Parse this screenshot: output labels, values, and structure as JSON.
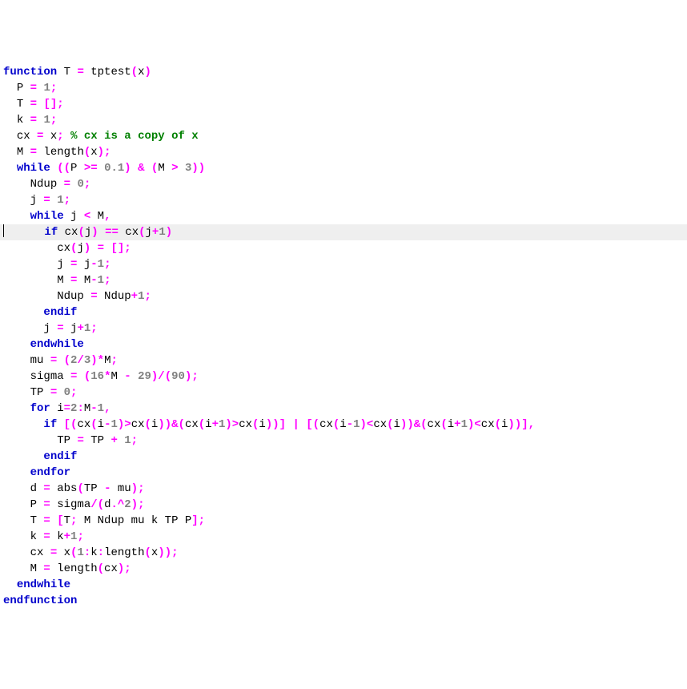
{
  "code": {
    "lines": [
      {
        "indent": 0,
        "hl": false,
        "tokens": [
          [
            "k",
            "function"
          ],
          [
            "id",
            " T "
          ],
          [
            "op",
            "="
          ],
          [
            "id",
            " tptest"
          ],
          [
            "op",
            "("
          ],
          [
            "id",
            "x"
          ],
          [
            "op",
            ")"
          ]
        ]
      },
      {
        "indent": 1,
        "hl": false,
        "tokens": [
          [
            "id",
            "P "
          ],
          [
            "op",
            "="
          ],
          [
            "id",
            " "
          ],
          [
            "n",
            "1"
          ],
          [
            "op",
            ";"
          ]
        ]
      },
      {
        "indent": 1,
        "hl": false,
        "tokens": [
          [
            "id",
            "T "
          ],
          [
            "op",
            "="
          ],
          [
            "id",
            " "
          ],
          [
            "op",
            "[];"
          ]
        ]
      },
      {
        "indent": 1,
        "hl": false,
        "tokens": [
          [
            "id",
            "k "
          ],
          [
            "op",
            "="
          ],
          [
            "id",
            " "
          ],
          [
            "n",
            "1"
          ],
          [
            "op",
            ";"
          ]
        ]
      },
      {
        "indent": 1,
        "hl": false,
        "tokens": [
          [
            "id",
            "cx "
          ],
          [
            "op",
            "="
          ],
          [
            "id",
            " x"
          ],
          [
            "op",
            ";"
          ],
          [
            "id",
            " "
          ],
          [
            "c",
            "% cx is a copy of x"
          ]
        ]
      },
      {
        "indent": 1,
        "hl": false,
        "tokens": [
          [
            "id",
            "M "
          ],
          [
            "op",
            "="
          ],
          [
            "id",
            " length"
          ],
          [
            "op",
            "("
          ],
          [
            "id",
            "x"
          ],
          [
            "op",
            ");"
          ]
        ]
      },
      {
        "indent": 1,
        "hl": false,
        "tokens": [
          [
            "k",
            "while"
          ],
          [
            "id",
            " "
          ],
          [
            "op",
            "(("
          ],
          [
            "id",
            "P "
          ],
          [
            "op",
            ">="
          ],
          [
            "id",
            " "
          ],
          [
            "n",
            "0.1"
          ],
          [
            "op",
            ")"
          ],
          [
            "id",
            " "
          ],
          [
            "op",
            "&"
          ],
          [
            "id",
            " "
          ],
          [
            "op",
            "("
          ],
          [
            "id",
            "M "
          ],
          [
            "op",
            ">"
          ],
          [
            "id",
            " "
          ],
          [
            "n",
            "3"
          ],
          [
            "op",
            "))"
          ]
        ]
      },
      {
        "indent": 2,
        "hl": false,
        "tokens": [
          [
            "id",
            "Ndup "
          ],
          [
            "op",
            "="
          ],
          [
            "id",
            " "
          ],
          [
            "n",
            "0"
          ],
          [
            "op",
            ";"
          ]
        ]
      },
      {
        "indent": 2,
        "hl": false,
        "tokens": [
          [
            "id",
            "j "
          ],
          [
            "op",
            "="
          ],
          [
            "id",
            " "
          ],
          [
            "n",
            "1"
          ],
          [
            "op",
            ";"
          ]
        ]
      },
      {
        "indent": 2,
        "hl": false,
        "tokens": [
          [
            "k",
            "while"
          ],
          [
            "id",
            " j "
          ],
          [
            "op",
            "<"
          ],
          [
            "id",
            " M"
          ],
          [
            "op",
            ","
          ]
        ]
      },
      {
        "indent": 3,
        "hl": true,
        "tokens": [
          [
            "k",
            "if"
          ],
          [
            "id",
            " cx"
          ],
          [
            "op",
            "("
          ],
          [
            "id",
            "j"
          ],
          [
            "op",
            ")"
          ],
          [
            "id",
            " "
          ],
          [
            "op",
            "=="
          ],
          [
            "id",
            " cx"
          ],
          [
            "op",
            "("
          ],
          [
            "id",
            "j"
          ],
          [
            "op",
            "+"
          ],
          [
            "n",
            "1"
          ],
          [
            "op",
            ")"
          ]
        ]
      },
      {
        "indent": 4,
        "hl": false,
        "tokens": [
          [
            "id",
            "cx"
          ],
          [
            "op",
            "("
          ],
          [
            "id",
            "j"
          ],
          [
            "op",
            ")"
          ],
          [
            "id",
            " "
          ],
          [
            "op",
            "="
          ],
          [
            "id",
            " "
          ],
          [
            "op",
            "[];"
          ]
        ]
      },
      {
        "indent": 4,
        "hl": false,
        "tokens": [
          [
            "id",
            "j "
          ],
          [
            "op",
            "="
          ],
          [
            "id",
            " j"
          ],
          [
            "op",
            "-"
          ],
          [
            "n",
            "1"
          ],
          [
            "op",
            ";"
          ]
        ]
      },
      {
        "indent": 4,
        "hl": false,
        "tokens": [
          [
            "id",
            "M "
          ],
          [
            "op",
            "="
          ],
          [
            "id",
            " M"
          ],
          [
            "op",
            "-"
          ],
          [
            "n",
            "1"
          ],
          [
            "op",
            ";"
          ]
        ]
      },
      {
        "indent": 4,
        "hl": false,
        "tokens": [
          [
            "id",
            "Ndup "
          ],
          [
            "op",
            "="
          ],
          [
            "id",
            " Ndup"
          ],
          [
            "op",
            "+"
          ],
          [
            "n",
            "1"
          ],
          [
            "op",
            ";"
          ]
        ]
      },
      {
        "indent": 3,
        "hl": false,
        "tokens": [
          [
            "k",
            "endif"
          ]
        ]
      },
      {
        "indent": 3,
        "hl": false,
        "tokens": [
          [
            "id",
            "j "
          ],
          [
            "op",
            "="
          ],
          [
            "id",
            " j"
          ],
          [
            "op",
            "+"
          ],
          [
            "n",
            "1"
          ],
          [
            "op",
            ";"
          ]
        ]
      },
      {
        "indent": 2,
        "hl": false,
        "tokens": [
          [
            "k",
            "endwhile"
          ]
        ]
      },
      {
        "indent": 2,
        "hl": false,
        "tokens": [
          [
            "id",
            "mu "
          ],
          [
            "op",
            "="
          ],
          [
            "id",
            " "
          ],
          [
            "op",
            "("
          ],
          [
            "n",
            "2"
          ],
          [
            "op",
            "/"
          ],
          [
            "n",
            "3"
          ],
          [
            "op",
            ")*"
          ],
          [
            "id",
            "M"
          ],
          [
            "op",
            ";"
          ]
        ]
      },
      {
        "indent": 2,
        "hl": false,
        "tokens": [
          [
            "id",
            "sigma "
          ],
          [
            "op",
            "="
          ],
          [
            "id",
            " "
          ],
          [
            "op",
            "("
          ],
          [
            "n",
            "16"
          ],
          [
            "op",
            "*"
          ],
          [
            "id",
            "M "
          ],
          [
            "op",
            "-"
          ],
          [
            "id",
            " "
          ],
          [
            "n",
            "29"
          ],
          [
            "op",
            ")/("
          ],
          [
            "n",
            "90"
          ],
          [
            "op",
            ");"
          ]
        ]
      },
      {
        "indent": 2,
        "hl": false,
        "tokens": [
          [
            "id",
            "TP "
          ],
          [
            "op",
            "="
          ],
          [
            "id",
            " "
          ],
          [
            "n",
            "0"
          ],
          [
            "op",
            ";"
          ]
        ]
      },
      {
        "indent": 2,
        "hl": false,
        "tokens": [
          [
            "k",
            "for"
          ],
          [
            "id",
            " i"
          ],
          [
            "op",
            "="
          ],
          [
            "n",
            "2"
          ],
          [
            "op",
            ":"
          ],
          [
            "id",
            "M"
          ],
          [
            "op",
            "-"
          ],
          [
            "n",
            "1"
          ],
          [
            "op",
            ","
          ]
        ]
      },
      {
        "indent": 3,
        "hl": false,
        "tokens": [
          [
            "k",
            "if"
          ],
          [
            "id",
            " "
          ],
          [
            "op",
            "[("
          ],
          [
            "id",
            "cx"
          ],
          [
            "op",
            "("
          ],
          [
            "id",
            "i"
          ],
          [
            "op",
            "-"
          ],
          [
            "n",
            "1"
          ],
          [
            "op",
            ")>"
          ],
          [
            "id",
            "cx"
          ],
          [
            "op",
            "("
          ],
          [
            "id",
            "i"
          ],
          [
            "op",
            "))&("
          ],
          [
            "id",
            "cx"
          ],
          [
            "op",
            "("
          ],
          [
            "id",
            "i"
          ],
          [
            "op",
            "+"
          ],
          [
            "n",
            "1"
          ],
          [
            "op",
            ")>"
          ],
          [
            "id",
            "cx"
          ],
          [
            "op",
            "("
          ],
          [
            "id",
            "i"
          ],
          [
            "op",
            "))]"
          ],
          [
            "id",
            " "
          ],
          [
            "op",
            "|"
          ],
          [
            "id",
            " "
          ],
          [
            "op",
            "[("
          ],
          [
            "id",
            "cx"
          ],
          [
            "op",
            "("
          ],
          [
            "id",
            "i"
          ],
          [
            "op",
            "-"
          ],
          [
            "n",
            "1"
          ],
          [
            "op",
            ")<"
          ],
          [
            "id",
            "cx"
          ],
          [
            "op",
            "("
          ],
          [
            "id",
            "i"
          ],
          [
            "op",
            "))&("
          ],
          [
            "id",
            "cx"
          ],
          [
            "op",
            "("
          ],
          [
            "id",
            "i"
          ],
          [
            "op",
            "+"
          ],
          [
            "n",
            "1"
          ],
          [
            "op",
            ")<"
          ],
          [
            "id",
            "cx"
          ],
          [
            "op",
            "("
          ],
          [
            "id",
            "i"
          ],
          [
            "op",
            "))],"
          ]
        ]
      },
      {
        "indent": 4,
        "hl": false,
        "tokens": [
          [
            "id",
            "TP "
          ],
          [
            "op",
            "="
          ],
          [
            "id",
            " TP "
          ],
          [
            "op",
            "+"
          ],
          [
            "id",
            " "
          ],
          [
            "n",
            "1"
          ],
          [
            "op",
            ";"
          ]
        ]
      },
      {
        "indent": 3,
        "hl": false,
        "tokens": [
          [
            "k",
            "endif"
          ]
        ]
      },
      {
        "indent": 2,
        "hl": false,
        "tokens": [
          [
            "k",
            "endfor"
          ]
        ]
      },
      {
        "indent": 2,
        "hl": false,
        "tokens": [
          [
            "id",
            "d "
          ],
          [
            "op",
            "="
          ],
          [
            "id",
            " abs"
          ],
          [
            "op",
            "("
          ],
          [
            "id",
            "TP "
          ],
          [
            "op",
            "-"
          ],
          [
            "id",
            " mu"
          ],
          [
            "op",
            ");"
          ]
        ]
      },
      {
        "indent": 2,
        "hl": false,
        "tokens": [
          [
            "id",
            "P "
          ],
          [
            "op",
            "="
          ],
          [
            "id",
            " sigma"
          ],
          [
            "op",
            "/("
          ],
          [
            "id",
            "d"
          ],
          [
            "op",
            ".^"
          ],
          [
            "n",
            "2"
          ],
          [
            "op",
            ");"
          ]
        ]
      },
      {
        "indent": 2,
        "hl": false,
        "tokens": [
          [
            "id",
            "T "
          ],
          [
            "op",
            "="
          ],
          [
            "id",
            " "
          ],
          [
            "op",
            "["
          ],
          [
            "id",
            "T"
          ],
          [
            "op",
            ";"
          ],
          [
            "id",
            " M Ndup mu k TP P"
          ],
          [
            "op",
            "];"
          ]
        ]
      },
      {
        "indent": 2,
        "hl": false,
        "tokens": [
          [
            "id",
            "k "
          ],
          [
            "op",
            "="
          ],
          [
            "id",
            " k"
          ],
          [
            "op",
            "+"
          ],
          [
            "n",
            "1"
          ],
          [
            "op",
            ";"
          ]
        ]
      },
      {
        "indent": 2,
        "hl": false,
        "tokens": [
          [
            "id",
            "cx "
          ],
          [
            "op",
            "="
          ],
          [
            "id",
            " x"
          ],
          [
            "op",
            "("
          ],
          [
            "n",
            "1"
          ],
          [
            "op",
            ":"
          ],
          [
            "id",
            "k"
          ],
          [
            "op",
            ":"
          ],
          [
            "id",
            "length"
          ],
          [
            "op",
            "("
          ],
          [
            "id",
            "x"
          ],
          [
            "op",
            "));"
          ]
        ]
      },
      {
        "indent": 2,
        "hl": false,
        "tokens": [
          [
            "id",
            "M "
          ],
          [
            "op",
            "="
          ],
          [
            "id",
            " length"
          ],
          [
            "op",
            "("
          ],
          [
            "id",
            "cx"
          ],
          [
            "op",
            ");"
          ]
        ]
      },
      {
        "indent": 1,
        "hl": false,
        "tokens": [
          [
            "k",
            "endwhile"
          ]
        ]
      },
      {
        "indent": 0,
        "hl": false,
        "tokens": [
          [
            "k",
            "endfunction"
          ]
        ]
      }
    ],
    "cursor_line_index": 10,
    "indent_unit": "  "
  }
}
